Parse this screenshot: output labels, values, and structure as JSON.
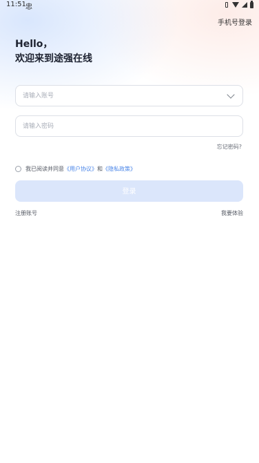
{
  "status_bar": {
    "time": "11:51",
    "app_icon_glyph": "忠"
  },
  "header": {
    "phone_login_label": "手机号登录"
  },
  "greeting": {
    "line1": "Hello，",
    "line2": "欢迎来到途强在线"
  },
  "form": {
    "account_placeholder": "请输入账号",
    "password_placeholder": "请输入密码",
    "forgot_label": "忘记密码?"
  },
  "agreement": {
    "prefix": "我已阅读并同意",
    "user_agreement": "《用户协议》",
    "and": "和",
    "privacy_policy": "《隐私政策》"
  },
  "login_button_label": "登录",
  "footer": {
    "register_label": "注册账号",
    "trial_label": "我要体验"
  }
}
